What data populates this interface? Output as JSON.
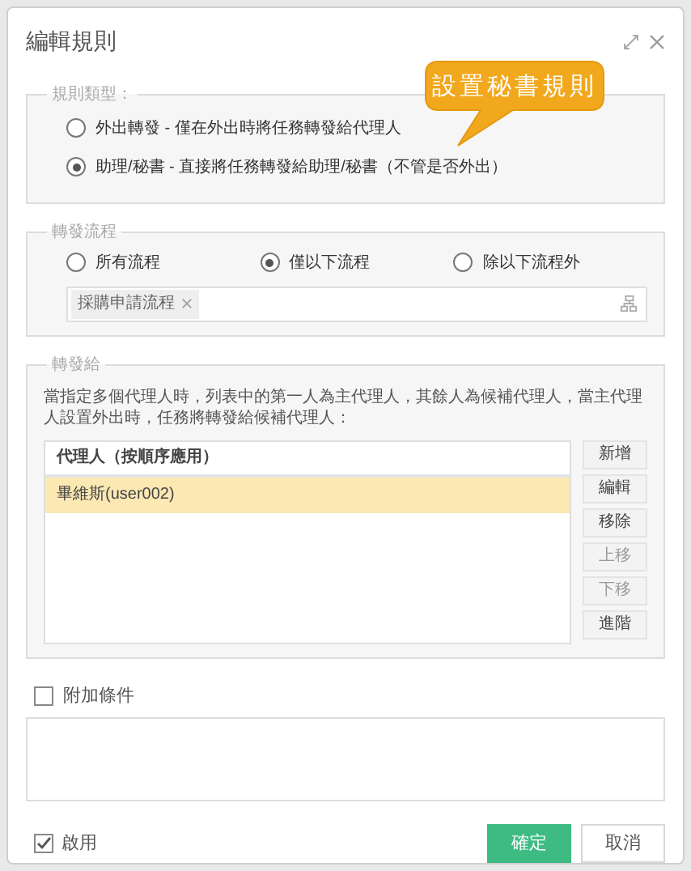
{
  "window": {
    "title": "編輯規則"
  },
  "callout": {
    "text": "設置秘書規則"
  },
  "rule_type": {
    "legend": "規則類型：",
    "options": [
      {
        "label": "外出轉發 - 僅在外出時將任務轉發給代理人",
        "selected": false
      },
      {
        "label": "助理/秘書 - 直接將任務轉發給助理/秘書（不管是否外出）",
        "selected": true
      }
    ]
  },
  "forward_process": {
    "legend": "轉發流程",
    "options": [
      {
        "label": "所有流程",
        "selected": false
      },
      {
        "label": "僅以下流程",
        "selected": true
      },
      {
        "label": "除以下流程外",
        "selected": false
      }
    ],
    "tags": [
      {
        "label": "採購申請流程"
      }
    ]
  },
  "forward_to": {
    "legend": "轉發給",
    "description": "當指定多個代理人時，列表中的第一人為主代理人，其餘人為候補代理人，當主代理人設置外出時，任務將轉發給候補代理人：",
    "table": {
      "columns": [
        "代理人（按順序應用）"
      ],
      "rows": [
        {
          "name": "畢維斯(user002)",
          "selected": true
        }
      ]
    },
    "buttons": [
      {
        "label": "新增",
        "disabled": false
      },
      {
        "label": "編輯",
        "disabled": false
      },
      {
        "label": "移除",
        "disabled": false
      },
      {
        "label": "上移",
        "disabled": true
      },
      {
        "label": "下移",
        "disabled": true
      },
      {
        "label": "進階",
        "disabled": false
      }
    ]
  },
  "extra_conditions": {
    "label": "附加條件",
    "checked": false
  },
  "enabled": {
    "label": "啟用",
    "checked": true
  },
  "footer_buttons": [
    {
      "label": "確定",
      "kind": "primary"
    },
    {
      "label": "取消",
      "kind": "secondary"
    }
  ]
}
